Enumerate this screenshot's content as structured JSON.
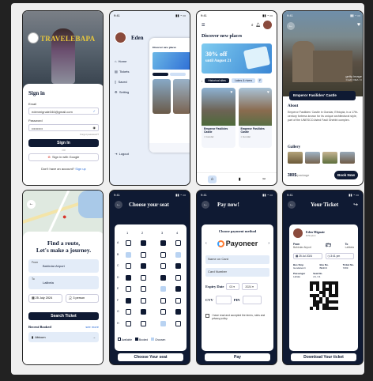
{
  "s1": {
    "logo": "TRAVELEBAPA",
    "title": "Sign in",
    "email_label": "Email",
    "email": "edenmignaie346@gmail.com",
    "password_label": "Password",
    "password": "••••••••••",
    "forgot": "Forgot password?",
    "or": "OR",
    "signin": "Sign In",
    "google": "Sign in with Google",
    "no_account": "Don't have an account?",
    "signup": "Sign up"
  },
  "s2": {
    "name": "Eden",
    "menu": [
      "Home",
      "Tickets",
      "Saved",
      "Setting"
    ],
    "logout": "Logout",
    "discover": "Discover new places",
    "promo": "30% off until August 21"
  },
  "s3": {
    "time": "9:41",
    "discover": "Discover new places",
    "promo_line1": "30% off",
    "promo_line2": "until August 21",
    "chips": [
      "Historical sites",
      "Lakes & rivers",
      "F"
    ],
    "card1_title": "Emperor Fasilides Castle",
    "card1_loc": "Gondar",
    "card2_title": "Emperor Fasilides Castle",
    "card2_loc": "Gondar"
  },
  "s4": {
    "time": "9:41",
    "place": "Emperor Fasilides' Castle",
    "about_title": "About",
    "about": "Emperor Fasilides' Castle in Gondar, Ethiopia, is a 17th-century fortress known for its unique architectural style, part of the UNESCO-listed Fasil Ghebbi complex.",
    "gallery": "Gallery",
    "price": "380$",
    "price_unit": "/package",
    "book": "Book Now",
    "watermark1": "getty image",
    "watermark2": "Credit: DEA / C"
  },
  "s5": {
    "title_line1": "Find a route,",
    "title_line2": "Let's make a journey.",
    "from_label": "From",
    "from": "Bahirdar Airport",
    "to_label": "To",
    "to": "Lalibela",
    "date": "25 July 2024",
    "passengers": "3 person",
    "search": "Search Ticket",
    "recent": "Recent Booked",
    "see_more": "see more",
    "recent_item": "Abicum"
  },
  "s6": {
    "time": "9:41",
    "title": "Choose your seat",
    "cols": [
      "1",
      "2",
      "3",
      "4"
    ],
    "rows": [
      "A",
      "B",
      "C",
      "D",
      "E",
      "F",
      "G",
      "H"
    ],
    "legend": [
      "Available",
      "Booked",
      "Choosen"
    ],
    "btn": "Choose Your seat"
  },
  "s7": {
    "time": "9:41",
    "title": "Pay now!",
    "method_label": "Choose payment method",
    "brand": "Payoneer",
    "name_ph": "Name on Card",
    "card_ph": "Card Number",
    "expiry": "Expiry Date",
    "month": "03",
    "year": "2024",
    "cvv": "CVV",
    "pin": "PIN",
    "terms": "I have read and accepted the terms, rules and privacy policy",
    "pay": "Pay"
  },
  "s8": {
    "time": "9:41",
    "title": "Your Ticket",
    "name": "Eden Mignaie",
    "city": "Ethiopian",
    "from_label": "From",
    "from": "Bahirdar Airport",
    "to_label": "To",
    "to": "Lalibela",
    "date": "25 Jul 2024",
    "clock": "3:41 pm",
    "bus_stop_label": "Bus Stop",
    "bus_stop": "Gondarenzi",
    "bus_no_label": "Bus No.",
    "bus_no": "BE3C3",
    "ticket_no_label": "Ticket No.",
    "ticket_no": "7299",
    "pass_label": "Passenger",
    "pass": "Lahale",
    "seat_label": "Seat No.",
    "seat": "A1, C1",
    "download": "Download Your ticket"
  },
  "colors": {
    "navy": "#0f1a33",
    "accent": "#2f6fd6",
    "seat_booked": "#0f1a33",
    "seat_chosen": "#b9d3f2"
  }
}
